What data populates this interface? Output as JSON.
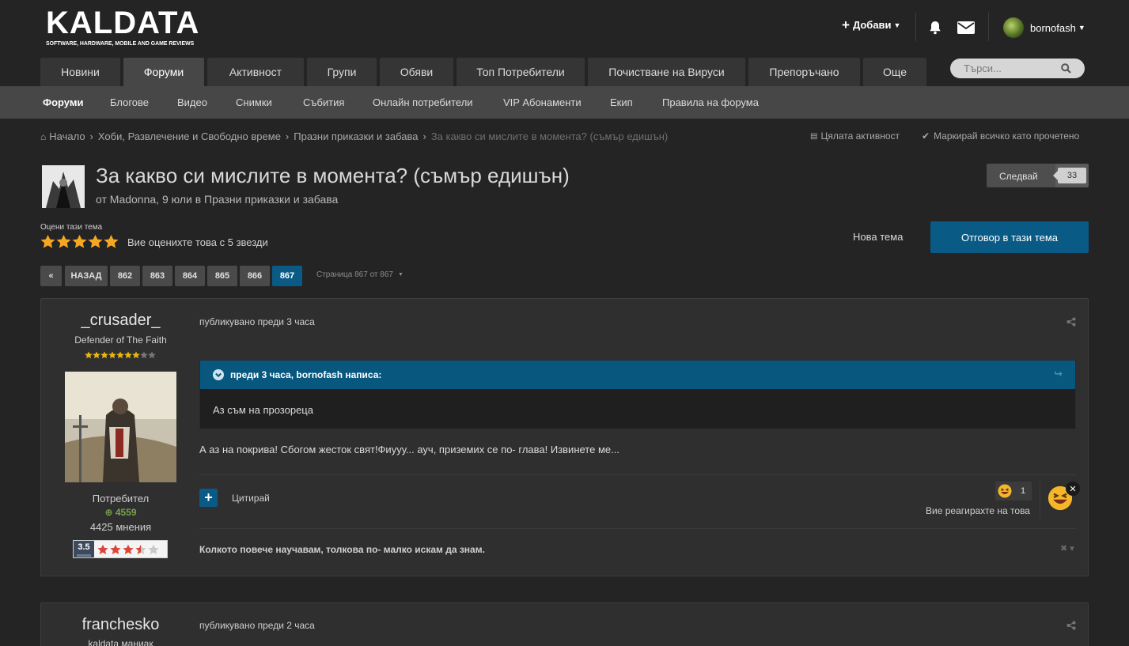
{
  "site": {
    "logo_text": "KALDATA",
    "logo_tagline": "SOFTWARE, HARDWARE, MOBILE AND GAME REVIEWS"
  },
  "user_bar": {
    "add_label": "Добави",
    "username": "bornofash"
  },
  "nav": {
    "tabs": [
      "Новини",
      "Форуми",
      "Активност",
      "Групи",
      "Обяви",
      "Топ Потребители",
      "Почистване на Вируси",
      "Препоръчано",
      "Още"
    ],
    "active_tab": "Форуми",
    "search_placeholder": "Търси..."
  },
  "subnav": [
    "Форуми",
    "Блогове",
    "Видео",
    "Снимки",
    "Събития",
    "Онлайн потребители",
    "VIP Абонаменти",
    "Екип",
    "Правила на форума"
  ],
  "breadcrumb": {
    "items": [
      "Начало",
      "Хоби, Развлечение и Свободно време",
      "Празни приказки и забава",
      "За какво си мислите в момента? (съмър едишън)"
    ],
    "all_activity": "Цялата активност",
    "mark_read": "Маркирай всичко като прочетено"
  },
  "topic": {
    "title": "За какво си мислите в момента? (съмър едишън)",
    "meta_prefix": "от",
    "author": "Madonna",
    "date": "9 юли",
    "meta_in": "в",
    "forum": "Празни приказки и забава",
    "follow_label": "Следвай",
    "follow_count": "33",
    "rate_label": "Оцени тази тема",
    "rating_stars": 5,
    "rating_text": "Вие оценихте това с 5 звезди",
    "new_topic": "Нова тема",
    "reply": "Отговор в тази тема"
  },
  "pagination": {
    "first": "«",
    "prev": "НАЗАД",
    "pages": [
      "862",
      "863",
      "864",
      "865",
      "866",
      "867"
    ],
    "current": "867",
    "page_info": "Страница 867 от 867"
  },
  "posts": [
    {
      "author": "_crusader_",
      "rank": "Defender of The Faith",
      "rank_stars": 7,
      "rank_stars_total": 9,
      "group": "Потребител",
      "reputation": "4559",
      "posts_count": "4425 мнения",
      "rating_value": "3.5",
      "rating_stars": 3.5,
      "posted": "публикувано преди 3 часа",
      "quote_header": "преди 3 часа, bornofash написа:",
      "quote_body": "Аз съм на прозореца",
      "body": "А аз на покрива! Сбогом жесток свят!Фиууу... ауч, приземих се по- глава! Извинете ме...",
      "quote_action": "Цитирай",
      "reaction_count": "1",
      "reacted_text": "Вие реагирахте на това",
      "signature": "Колкото повече научавам, толкова по- малко искам да знам."
    },
    {
      "author": "franchesko",
      "rank": "kaldata маниак",
      "posted": "публикувано преди 2 часа"
    }
  ],
  "colors": {
    "accent": "#0a5a86",
    "reputation": "#7aa24c",
    "star": "#f5a623"
  }
}
